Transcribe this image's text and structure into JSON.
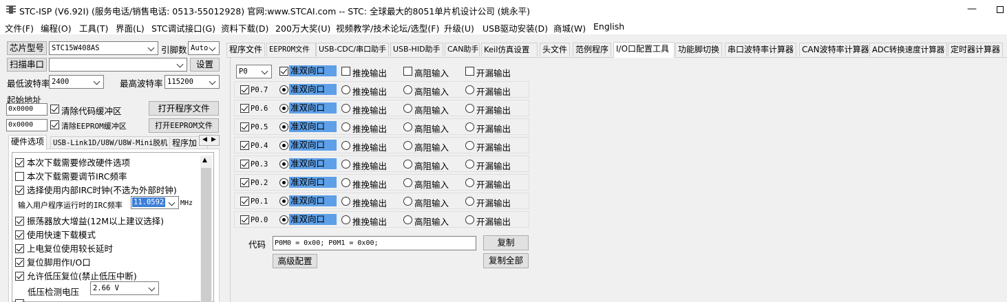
{
  "window": {
    "title": "STC-ISP (V6.92I) (服务电话/销售电话: 0513-55012928) 官网:www.STCAI.com  -- STC: 全球最大的8051单片机设计公司 (姚永平)",
    "minimize_glyph": "—"
  },
  "menu": [
    "文件(F)",
    "编程(O)",
    "工具(T)",
    "界面(L)",
    "STC调试接口(G)",
    "资料下载(D)",
    "200万大奖(U)",
    "视频教学/技术论坛/选型(F)",
    "升级(U)",
    "USB驱动安装(D)",
    "商城(W)",
    "English"
  ],
  "left": {
    "chip_label": "芯片型号",
    "chip_value": "STC15W408AS",
    "pins_label": "引脚数",
    "pins_value": "Auto",
    "scan_label": "扫描串口",
    "port_value": "",
    "settings_label": "设置",
    "min_baud_label": "最低波特率",
    "min_baud_value": "2400",
    "max_baud_label": "最高波特率",
    "max_baud_value": "115200",
    "start_addr_label": "起始地址",
    "addr1": "0x0000",
    "clear_code_label": "清除代码缓冲区",
    "open_prog_label": "打开程序文件",
    "addr2": "0x0000",
    "clear_eeprom_label": "清除EEPROM缓冲区",
    "open_eeprom_label": "打开EEPROM文件",
    "subtabs": [
      "硬件选项",
      "USB-Link1D/U8W/U8W-Mini脱机",
      "程序加"
    ],
    "hw_options": [
      {
        "text": "本次下载需要修改硬件选项",
        "checked": true
      },
      {
        "text": "本次下载需要调节IRC频率",
        "checked": false
      },
      {
        "text": "选择使用内部IRC时钟(不选为外部时钟)",
        "checked": true
      },
      {
        "text": "输入用户程序运行时的IRC频率",
        "checked": null
      },
      {
        "text": "振荡器放大增益(12M以上建议选择)",
        "checked": true
      },
      {
        "text": "使用快速下载模式",
        "checked": true
      },
      {
        "text": "上电复位使用较长延时",
        "checked": true
      },
      {
        "text": "复位脚用作I/O口",
        "checked": true
      },
      {
        "text": "允许低压复位(禁止低压中断)",
        "checked": true
      },
      {
        "text": "低压检测电压",
        "checked": null
      }
    ],
    "irc_freq_value": "11.0592",
    "irc_unit": "MHz",
    "lv_value": "2.66 V"
  },
  "tabs": [
    "程序文件",
    "EEPROM文件",
    "USB-CDC/串口助手",
    "USB-HID助手",
    "CAN助手",
    "Keil仿真设置",
    "头文件",
    "范例程序",
    "I/O口配置工具",
    "功能脚切换",
    "串口波特率计算器",
    "CAN波特率计算器",
    "ADC转换速度计算器",
    "定时器计算器"
  ],
  "active_tab": "I/O口配置工具",
  "io": {
    "port_value": "P0",
    "modes": [
      "准双向口",
      "推挽输出",
      "高阻输入",
      "开漏输出"
    ],
    "pins": [
      {
        "name": "P0.7",
        "checked": true,
        "mode": 0
      },
      {
        "name": "P0.6",
        "checked": true,
        "mode": 0
      },
      {
        "name": "P0.5",
        "checked": true,
        "mode": 0
      },
      {
        "name": "P0.4",
        "checked": true,
        "mode": 0
      },
      {
        "name": "P0.3",
        "checked": true,
        "mode": 0
      },
      {
        "name": "P0.2",
        "checked": true,
        "mode": 0
      },
      {
        "name": "P0.1",
        "checked": true,
        "mode": 0
      },
      {
        "name": "P0.0",
        "checked": true,
        "mode": 0
      }
    ],
    "code_label": "代码",
    "code_value": "P0M0 = 0x00; P0M1 = 0x00;",
    "copy_label": "复制",
    "advanced_label": "高级配置",
    "copy_all_label": "复制全部"
  },
  "colors": {
    "highlight": "#5ea0e8"
  }
}
